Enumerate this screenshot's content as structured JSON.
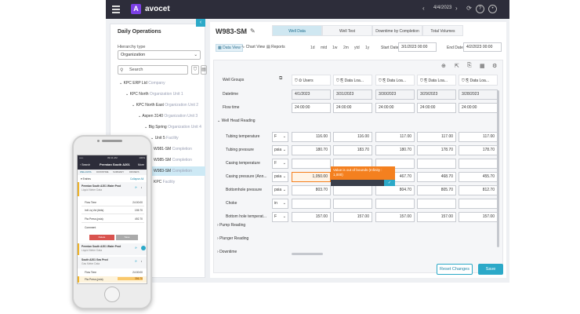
{
  "topbar": {
    "brand": "avocet",
    "date": "4/4/2023",
    "prev_icon": "chevron-left-icon",
    "next_icon": "chevron-right-icon",
    "refresh_icon": "refresh-icon",
    "help_icon": "help-icon",
    "user_icon": "user-icon"
  },
  "left": {
    "title": "Daily Operations",
    "hierarchy_label": "Hierarchy type",
    "hierarchy_value": "Organization",
    "search_placeholder": "Search",
    "tree": [
      {
        "name": "KPC ERP Ltd",
        "type": "Company"
      },
      {
        "name": "KPC North",
        "type": "Organization Unit 1"
      },
      {
        "name": "KPC North East",
        "type": "Organization Unit 2"
      },
      {
        "name": "Aspen 3140",
        "type": "Organization Unit 3"
      },
      {
        "name": "Big Spring",
        "type": "Organization Unit 4"
      },
      {
        "name": "Unit 5",
        "type": "Facility"
      },
      {
        "name": "W981-SM",
        "type": "Completion"
      },
      {
        "name": "W985-SM",
        "type": "Completion"
      },
      {
        "name": "W983-SM",
        "type": "Completion"
      },
      {
        "name": "KPC",
        "type": "Facility"
      }
    ]
  },
  "main": {
    "well": "W983-SM",
    "tabs": [
      "Well Data",
      "Well Test",
      "Downtime by Completion",
      "Total Volumes"
    ],
    "views": [
      "Data View",
      "Chart View",
      "Reports"
    ],
    "ranges": [
      "1d",
      "mtd",
      "1w",
      "2m",
      "ytd",
      "1y"
    ],
    "start_label": "Start Date",
    "start_value": "3/1/2023 00:00",
    "end_label": "End Date",
    "end_value": "4/2/2023 00:00",
    "groups_label": "Well Groups",
    "columns": [
      "Users",
      "Data Loa...",
      "Data Loa...",
      "Data Loa...",
      "Data Loa..."
    ],
    "dates": [
      "4/1/2023",
      "3/31/2023",
      "3/30/2023",
      "3/29/2023",
      "3/28/2023"
    ],
    "flow_times": [
      "24:00:00",
      "24:00:00",
      "24:00:00",
      "24:00:00",
      "24:00:00"
    ],
    "row_labels": {
      "datetime": "Datetime",
      "flowtime": "Flow time"
    },
    "section_whr": "Well Head Reading",
    "readings": [
      {
        "label": "Tubing temperature",
        "unit": "F",
        "values": [
          "116.00",
          "116.00",
          "117.00",
          "117.00",
          "117.00"
        ]
      },
      {
        "label": "Tubing pressure",
        "unit": "psia",
        "values": [
          "180.70",
          "183.70",
          "180.70",
          "178.70",
          "178.70"
        ]
      },
      {
        "label": "Casing temperature",
        "unit": "F",
        "values": [
          "",
          "",
          "",
          "",
          ""
        ]
      },
      {
        "label": "Casing pressure (Ann...",
        "unit": "psia",
        "values": [
          "1,050.00",
          "",
          "467.70",
          "468.70",
          "455.70"
        ]
      },
      {
        "label": "Bottomhole pressure",
        "unit": "psia",
        "values": [
          "803.70",
          "",
          "804.70",
          "805.70",
          "812.70"
        ]
      },
      {
        "label": "Choke",
        "unit": "in",
        "values": [
          "",
          "",
          "",
          "",
          ""
        ]
      },
      {
        "label": "Bottom hole temperat...",
        "unit": "F",
        "values": [
          "157.00",
          "157.00",
          "157.00",
          "157.00",
          "157.00"
        ]
      }
    ],
    "sections_after": [
      "Pump Reading",
      "Plunger Reading",
      "Downtime"
    ],
    "warning": "Value is out of bounds (Infinity : 1,000)",
    "reset_label": "Reset Changes",
    "save_label": "Save"
  },
  "phone": {
    "status_left": "•••••",
    "status_time": "09:41 AM",
    "status_right": "100%",
    "back": "Search",
    "title": "Permian South A201",
    "more": "More",
    "tabs": [
      "WELLDATA",
      "DOWNTIME",
      "SUMMARY",
      "DRIVERS"
    ],
    "section": "Entries",
    "collapse": "Collapse All",
    "well1": "Permian South A201 Water Prod",
    "well1_sub": "Liquid Meter Data",
    "flow_time_label": "Flow Time",
    "flow_time_value": "24:00:00",
    "vol_label": "Init Liq Vol (bbls)",
    "vol_value": "155.70",
    "press_label": "Flw Press (psia)",
    "press_value": "492.70",
    "comment_label": "Comment",
    "delete": "Delete",
    "save": "Save",
    "well2": "Permian South A201 Water Prod",
    "well2_sub": "Liquid Meter Data",
    "well3": "South A201 Gas Prod",
    "well3_sub": "Gas Meter Data",
    "flow_time_value2": "24:00:00",
    "press_value2": "356.70"
  }
}
